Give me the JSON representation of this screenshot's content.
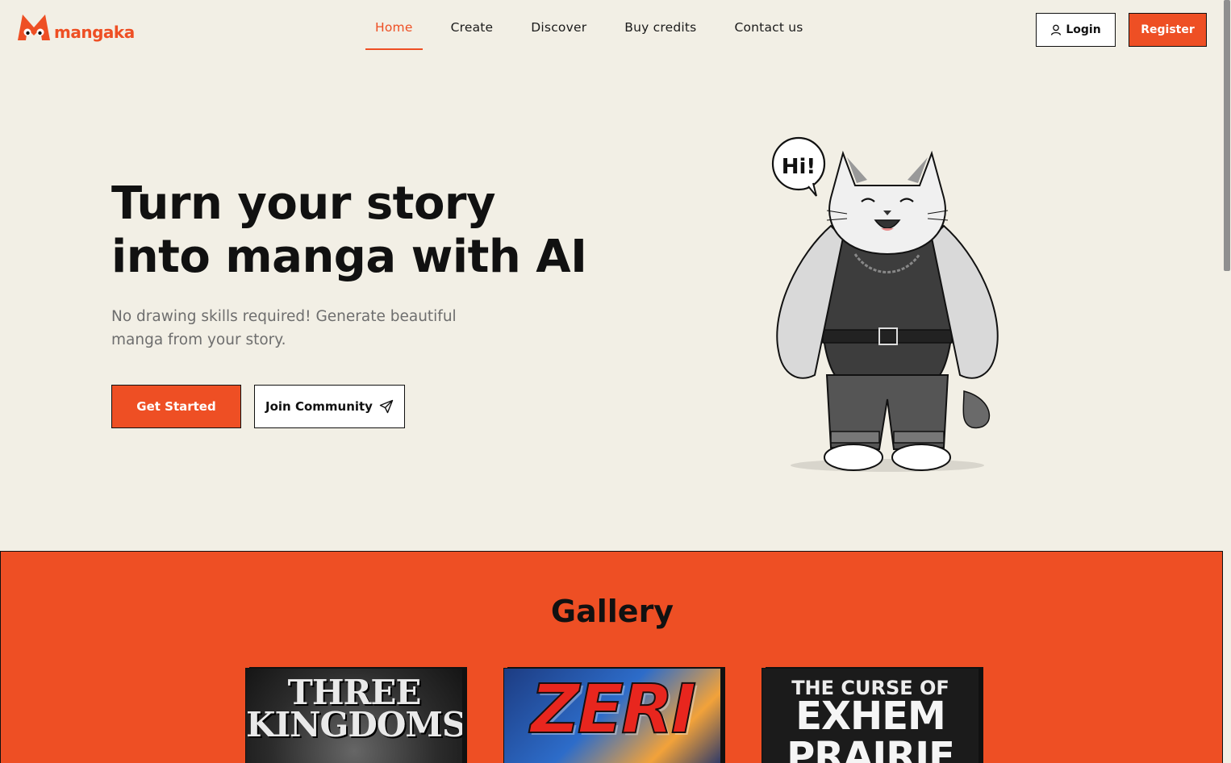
{
  "brand": {
    "name": "mangaka",
    "accent": "#ee4f24"
  },
  "nav": {
    "items": [
      {
        "label": "Home",
        "active": true
      },
      {
        "label": "Create",
        "active": false
      },
      {
        "label": "Discover",
        "active": false
      },
      {
        "label": "Buy credits",
        "active": false
      },
      {
        "label": "Contact us",
        "active": false
      }
    ]
  },
  "auth": {
    "login_label": "Login",
    "register_label": "Register",
    "login_icon": "user-icon"
  },
  "hero": {
    "title_line1": "Turn your story",
    "title_line2": "into manga with AI",
    "subtitle_line1": "No drawing skills required! Generate beautiful",
    "subtitle_line2": "manga from your story.",
    "primary_cta": "Get Started",
    "secondary_cta": "Join Community",
    "secondary_icon": "paper-plane-icon",
    "mascot_speech": "Hi!"
  },
  "gallery": {
    "title": "Gallery",
    "covers": [
      {
        "title_line1": "THREE",
        "title_line2": "KINGDOMS"
      },
      {
        "title_line1": "ZERI"
      },
      {
        "title_line1": "THE CURSE OF",
        "title_line2": "EXHEM",
        "title_line3": "PRAIRIE"
      }
    ]
  }
}
